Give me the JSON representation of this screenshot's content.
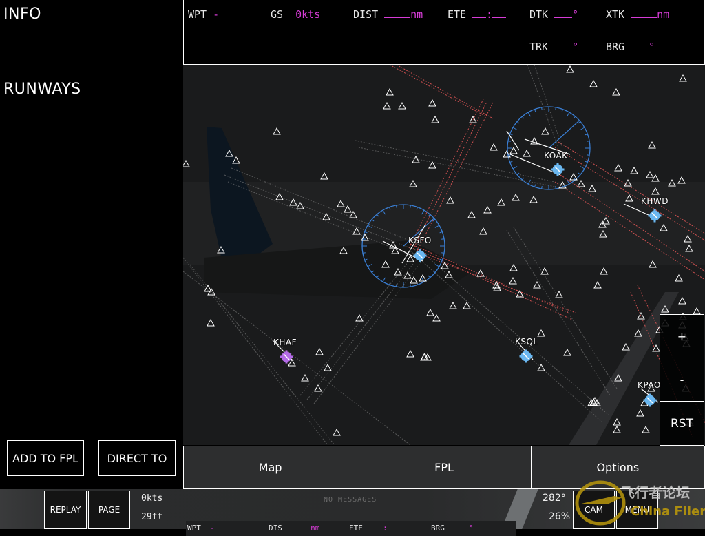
{
  "left_panel": {
    "info_title": "INFO",
    "runways_title": "RUNWAYS",
    "add_to_fpl_label": "ADD TO FPL",
    "direct_to_label": "DIRECT TO"
  },
  "nav_strip": {
    "wpt_label": "WPT",
    "wpt_value": "-",
    "gs_label": "GS",
    "gs_value": "0kts",
    "dist_label": "DIST",
    "dist_unit": "nm",
    "ete_label": "ETE",
    "ete_sep": ":",
    "dtk_label": "DTK",
    "deg": "°",
    "xtk_label": "XTK",
    "xtk_unit": "nm",
    "trk_label": "TRK",
    "brg_label": "BRG"
  },
  "map": {
    "airports": [
      {
        "id": "KSFO",
        "type": "towered"
      },
      {
        "id": "KOAK",
        "type": "towered"
      },
      {
        "id": "KHWD",
        "type": "towered"
      },
      {
        "id": "KHAF",
        "type": "non-towered"
      },
      {
        "id": "KSQL",
        "type": "towered"
      },
      {
        "id": "KPAO",
        "type": "towered"
      }
    ],
    "zoom_in_label": "+",
    "zoom_out_label": "-",
    "reset_label": "RST",
    "colors": {
      "background": "#1a1b1c",
      "compass_rose": "#3a7fd5",
      "towered_airport": "#6ab7f0",
      "nontowered_airport": "#b36ae6",
      "approach_red": "#e05555",
      "approach_gray": "#8a8a8a",
      "waypoint": "#ffffff"
    }
  },
  "tabs": [
    {
      "label": "Map"
    },
    {
      "label": "FPL"
    },
    {
      "label": "Options"
    }
  ],
  "status_bar": {
    "replay_label": "REPLAY",
    "page_label": "PAGE",
    "speed": "0kts",
    "altitude": "29ft",
    "messages": "NO MESSAGES",
    "heading": "282°",
    "throttle": "26%",
    "cam_label": "CAM",
    "menu_label": "MENU",
    "nav": {
      "wpt_label": "WPT",
      "wpt_value": "-",
      "dis_label": "DIS",
      "dis_unit": "nm",
      "ete_label": "ETE",
      "ete_sep": ":",
      "brg_label": "BRG",
      "deg": "°"
    }
  },
  "watermark": {
    "text_cn": "飞行者论坛",
    "text_en": "China Flier"
  }
}
